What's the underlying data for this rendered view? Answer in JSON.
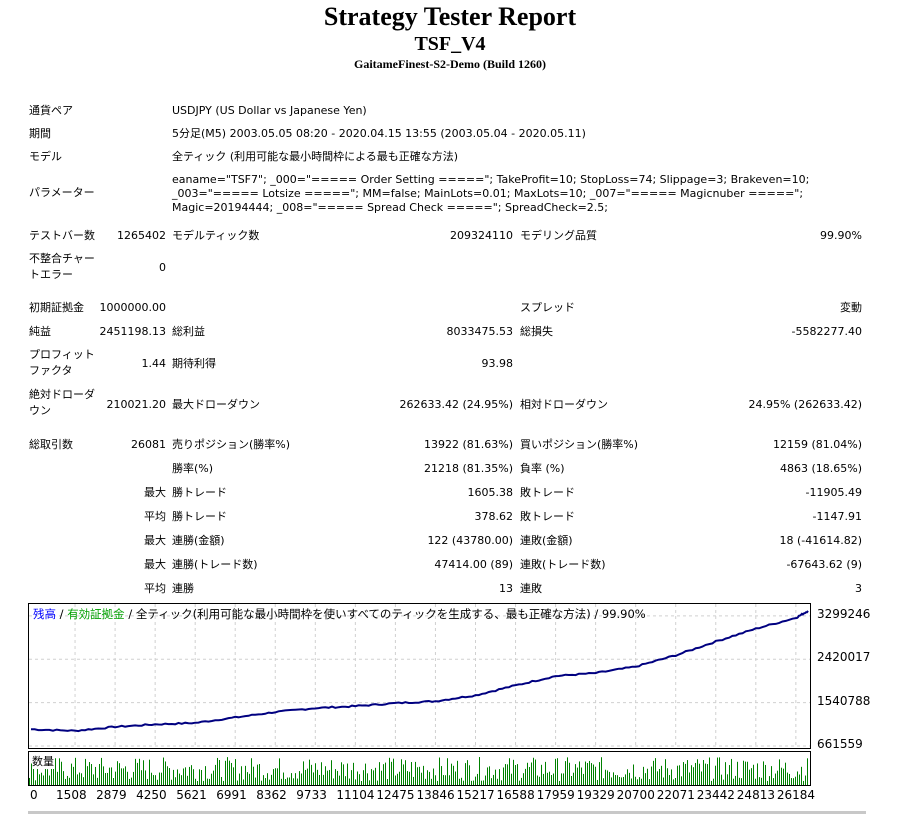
{
  "header": {
    "title": "Strategy Tester Report",
    "expert": "TSF_V4",
    "server": "GaitameFinest-S2-Demo (Build 1260)"
  },
  "settings": {
    "symbol_label": "通貨ペア",
    "symbol_value": "USDJPY (US Dollar vs Japanese Yen)",
    "period_label": "期間",
    "period_value": "5分足(M5) 2003.05.05 08:20 - 2020.04.15 13:55 (2003.05.04 - 2020.05.11)",
    "model_label": "モデル",
    "model_value": "全ティック (利用可能な最小時間枠による最も正確な方法)",
    "params_label": "パラメーター",
    "params_value": "eaname=\"TSF7\"; _000=\"===== Order Setting =====\"; TakeProfit=10; StopLoss=74; Slippage=3; Brakeven=10; _003=\"===== Lotsize =====\"; MM=false; MainLots=0.01; MaxLots=10; _007=\"===== Magicnuber =====\"; Magic=20194444; _008=\"===== Spread Check =====\"; SpreadCheck=2.5;"
  },
  "stats": {
    "bars_label": "テストバー数",
    "bars_value": "1265402",
    "ticks_label": "モデルティック数",
    "ticks_value": "209324110",
    "quality_label": "モデリング品質",
    "quality_value": "99.90%",
    "mismatch_label_1": "不整合チャー",
    "mismatch_label_2": "トエラー",
    "mismatch_value": "0",
    "deposit_label": "初期証拠金",
    "deposit_value": "1000000.00",
    "spread_label": "スプレッド",
    "spread_value": "変動",
    "net_label": "純益",
    "net_value": "2451198.13",
    "gross_profit_label": "総利益",
    "gross_profit_value": "8033475.53",
    "gross_loss_label": "総損失",
    "gross_loss_value": "-5582277.40",
    "pf_label_1": "プロフィット",
    "pf_label_2": "ファクタ",
    "pf_value": "1.44",
    "expected_label": "期待利得",
    "expected_value": "93.98",
    "abs_dd_label_1": "絶対ドローダ",
    "abs_dd_label_2": "ウン",
    "abs_dd_value": "210021.20",
    "max_dd_label": "最大ドローダウン",
    "max_dd_value": "262633.42 (24.95%)",
    "rel_dd_label": "相対ドローダウン",
    "rel_dd_value": "24.95% (262633.42)",
    "total_label": "総取引数",
    "total_value": "26081",
    "short_label": "売りポジション(勝率%)",
    "short_value": "13922 (81.63%)",
    "long_label": "買いポジション(勝率%)",
    "long_value": "12159 (81.04%)",
    "win_rate_label": "勝率(%)",
    "win_rate_value": "21218 (81.35%)",
    "loss_rate_label": "負率 (%)",
    "loss_rate_value": "4863 (18.65%)",
    "max_label": "最大",
    "avg_label": "平均",
    "largest_win_label": "勝トレード",
    "largest_win_value": "1605.38",
    "largest_loss_label": "敗トレード",
    "largest_loss_value": "-11905.49",
    "avg_win_label": "勝トレード",
    "avg_win_value": "378.62",
    "avg_loss_label": "敗トレード",
    "avg_loss_value": "-1147.91",
    "cons_wins_amt_label": "連勝(金額)",
    "cons_wins_amt_value": "122 (43780.00)",
    "cons_loss_amt_label": "連敗(金額)",
    "cons_loss_amt_value": "18 (-41614.82)",
    "cons_profit_label": "連勝(トレード数)",
    "cons_profit_value": "47414.00 (89)",
    "cons_loss_label": "連敗(トレード数)",
    "cons_loss_value": "-67643.62 (9)",
    "avg_cons_win_label": "連勝",
    "avg_cons_win_value": "13",
    "avg_cons_loss_label": "連敗",
    "avg_cons_loss_value": "3"
  },
  "chart_legend": {
    "balance": "残高",
    "sep1": " / ",
    "equity": "有効証拠金",
    "rest": " / 全ティック(利用可能な最小時間枠を使いすべてのティックを生成する、最も正確な方法) / 99.90%",
    "balance_color": "#0000ff",
    "equity_color": "#00a000"
  },
  "volume_label": "数量",
  "chart_data": {
    "type": "line",
    "series": [
      {
        "name": "残高",
        "color": "#000080"
      }
    ],
    "y_ticks": [
      "3299246",
      "2420017",
      "1540788",
      "661559"
    ],
    "x_ticks": [
      "0",
      "1508",
      "2879",
      "4250",
      "5621",
      "6991",
      "8362",
      "9733",
      "11104",
      "12475",
      "13846",
      "15217",
      "16588",
      "17959",
      "19329",
      "20700",
      "22071",
      "23442",
      "24813",
      "26184"
    ],
    "x": [
      0,
      1508,
      2879,
      4250,
      5621,
      6991,
      8362,
      9733,
      11104,
      12475,
      13846,
      15217,
      16588,
      17959,
      19329,
      20700,
      22071,
      23442,
      24813,
      26184,
      26600
    ],
    "y": [
      1000000,
      970000,
      1050000,
      1100000,
      1130000,
      1240000,
      1350000,
      1430000,
      1470000,
      1530000,
      1570000,
      1690000,
      1890000,
      2080000,
      2140000,
      2270000,
      2500000,
      2780000,
      3040000,
      3260000,
      3400000
    ],
    "ylim": [
      661559,
      3500000
    ],
    "grid": true
  }
}
